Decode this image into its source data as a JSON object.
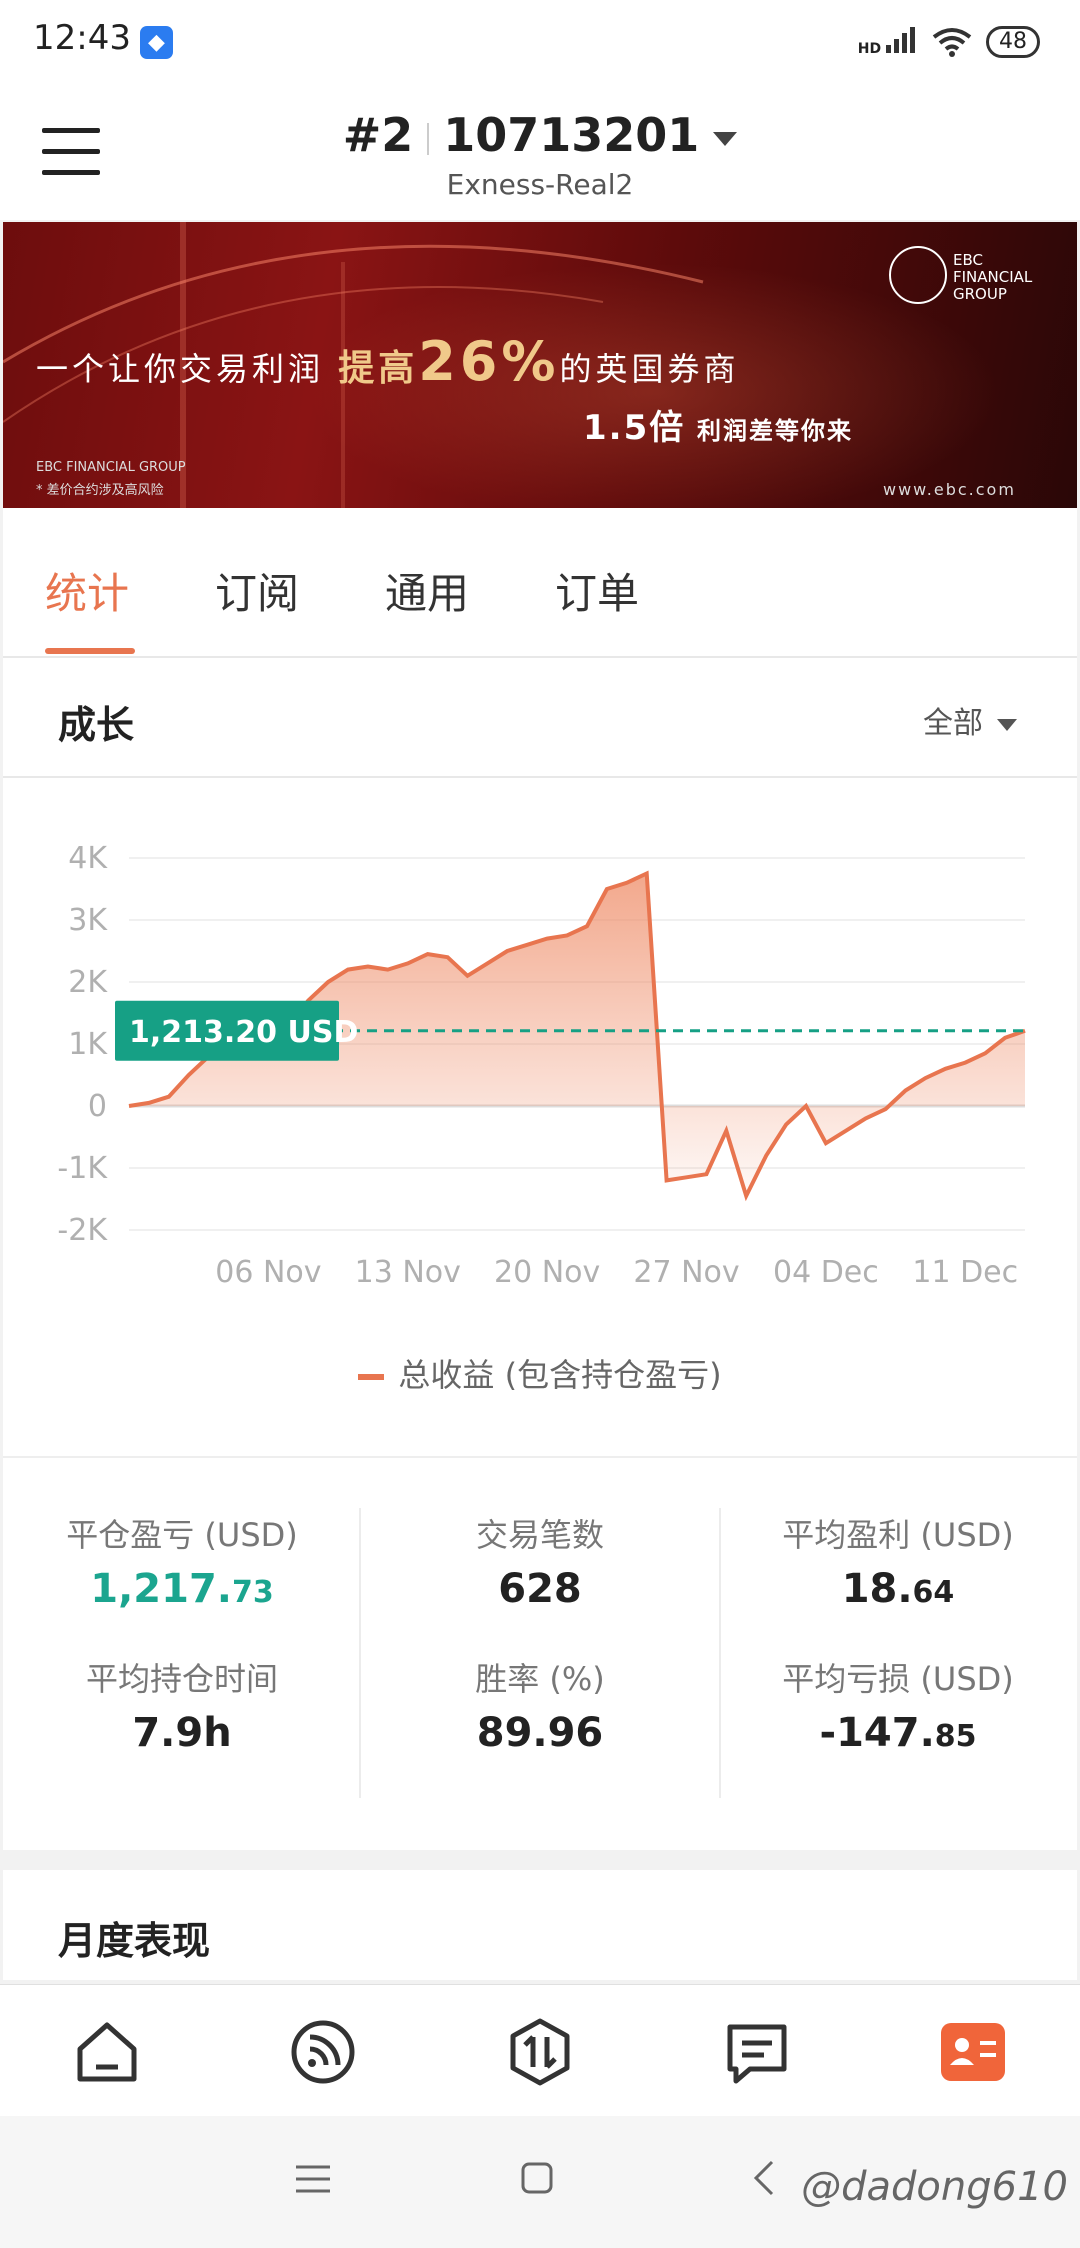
{
  "status_bar": {
    "time": "12:43",
    "network": "HD",
    "battery": "48"
  },
  "header": {
    "account_index": "#2",
    "account_number": "10713201",
    "server": "Exness-Real2"
  },
  "banner": {
    "line1_prefix": "一个让你交易利润",
    "line1_emph": "提高",
    "line1_big": "26%",
    "line1_suffix": "的英国券商",
    "line2_big": "1.5倍",
    "line2_suffix": "利润差等你来",
    "brand": "EBC FINANCIAL GROUP",
    "foot1": "EBC FINANCIAL GROUP",
    "foot2": "* 差价合约涉及高风险",
    "url": "www.ebc.com"
  },
  "tabs": [
    {
      "label": "统计",
      "active": true
    },
    {
      "label": "订阅",
      "active": false
    },
    {
      "label": "通用",
      "active": false
    },
    {
      "label": "订单",
      "active": false
    }
  ],
  "growth": {
    "title": "成长",
    "filter": "全部"
  },
  "chart_data": {
    "type": "area",
    "y_ticks": [
      "4K",
      "3K",
      "2K",
      "1K",
      "0",
      "-1K",
      "-2K"
    ],
    "ylim": [
      -2000,
      4000
    ],
    "x_ticks": [
      "06 Nov",
      "13 Nov",
      "20 Nov",
      "27 Nov",
      "04 Dec",
      "11 Dec"
    ],
    "current_value_label": "1,213.20 USD",
    "current_value": 1213.2,
    "series": [
      {
        "name": "总收益 (包含持仓盈亏)",
        "points": [
          [
            "30 Oct",
            0
          ],
          [
            "31 Oct",
            50
          ],
          [
            "1 Nov",
            150
          ],
          [
            "2 Nov",
            500
          ],
          [
            "3 Nov",
            800
          ],
          [
            "4 Nov",
            950
          ],
          [
            "5 Nov",
            1100
          ],
          [
            "6 Nov",
            1200
          ],
          [
            "7 Nov",
            1300
          ],
          [
            "8 Nov",
            1700
          ],
          [
            "9 Nov",
            2000
          ],
          [
            "10 Nov",
            2200
          ],
          [
            "11 Nov",
            2250
          ],
          [
            "12 Nov",
            2200
          ],
          [
            "13 Nov",
            2300
          ],
          [
            "14 Nov",
            2450
          ],
          [
            "15 Nov",
            2400
          ],
          [
            "16 Nov",
            2100
          ],
          [
            "17 Nov",
            2300
          ],
          [
            "18 Nov",
            2500
          ],
          [
            "19 Nov",
            2600
          ],
          [
            "20 Nov",
            2700
          ],
          [
            "21 Nov",
            2750
          ],
          [
            "22 Nov",
            2900
          ],
          [
            "23 Nov",
            3500
          ],
          [
            "24 Nov",
            3600
          ],
          [
            "25 Nov",
            3750
          ],
          [
            "26 Nov",
            -1200
          ],
          [
            "27 Nov",
            -1150
          ],
          [
            "28 Nov",
            -1100
          ],
          [
            "29 Nov",
            -400
          ],
          [
            "30 Nov",
            -1450
          ],
          [
            "1 Dec",
            -800
          ],
          [
            "2 Dec",
            -300
          ],
          [
            "3 Dec",
            0
          ],
          [
            "4 Dec",
            -600
          ],
          [
            "5 Dec",
            -400
          ],
          [
            "6 Dec",
            -200
          ],
          [
            "7 Dec",
            -50
          ],
          [
            "8 Dec",
            250
          ],
          [
            "9 Dec",
            450
          ],
          [
            "10 Dec",
            600
          ],
          [
            "11 Dec",
            700
          ],
          [
            "12 Dec",
            850
          ],
          [
            "13 Dec",
            1100
          ],
          [
            "14 Dec",
            1213
          ]
        ]
      }
    ],
    "legend": "总收益 (包含持仓盈亏)",
    "grid": true,
    "colors": {
      "line": "#e8754f",
      "marker": "#16a085"
    }
  },
  "stats": [
    {
      "label": "平仓盈亏 (USD)",
      "int": "1,217.",
      "dec": "73",
      "green": true
    },
    {
      "label": "交易笔数",
      "int": "628",
      "dec": "",
      "green": false
    },
    {
      "label": "平均盈利 (USD)",
      "int": "18.",
      "dec": "64",
      "green": false
    },
    {
      "label": "平均持仓时间",
      "int": "7.9h",
      "dec": "",
      "green": false
    },
    {
      "label": "胜率 (%)",
      "int": "89.96",
      "dec": "",
      "green": false
    },
    {
      "label": "平均亏损 (USD)",
      "int": "-147.",
      "dec": "85",
      "green": false
    }
  ],
  "monthly": {
    "title": "月度表现"
  },
  "bottom_nav": [
    "home-icon",
    "feed-icon",
    "trade-icon",
    "list-icon",
    "profile-card-icon"
  ],
  "watermark": "@dadong610"
}
